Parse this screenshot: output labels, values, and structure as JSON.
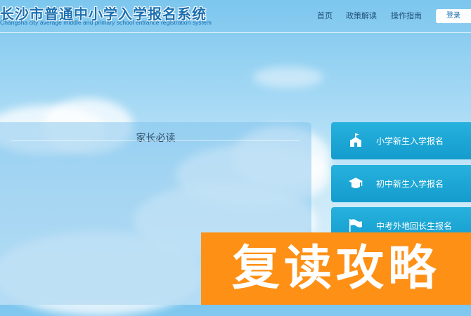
{
  "header": {
    "logo_cn": "长沙市普通中小学入学报名系统",
    "logo_en": "Changsha city average middle and primary school entrance registration system",
    "nav": [
      {
        "label": "首页"
      },
      {
        "label": "政策解读"
      },
      {
        "label": "操作指南"
      }
    ],
    "login_label": "登录"
  },
  "notice": {
    "title": "家长必读"
  },
  "menu": [
    {
      "label": "小学新生入学报名",
      "icon": "school-building-icon"
    },
    {
      "label": "初中新生入学报名",
      "icon": "graduation-cap-icon"
    },
    {
      "label": "中考外地回长生报名",
      "icon": "flag-icon"
    }
  ],
  "banner": {
    "text": "复读攻略",
    "color": "#fe9016"
  },
  "colors": {
    "accent": "#1b6fb0",
    "menu_button": "#1ba6d6"
  }
}
